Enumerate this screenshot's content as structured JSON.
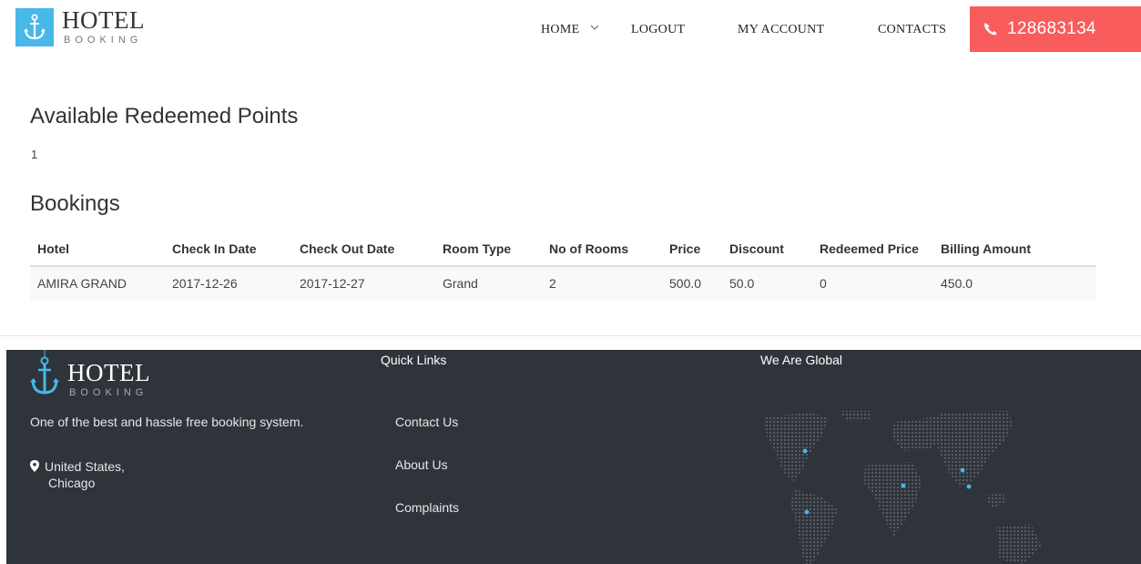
{
  "header": {
    "logo_title": "HOTEL",
    "logo_sub": "BOOKING",
    "nav": {
      "home": "HOME",
      "logout": "LOGOUT",
      "my_account": "MY ACCOUNT",
      "contacts": "CONTACTS"
    },
    "phone": "128683134"
  },
  "points": {
    "title": "Available Redeemed Points",
    "value": "1"
  },
  "bookings": {
    "title": "Bookings",
    "columns": [
      "Hotel",
      "Check In Date",
      "Check Out Date",
      "Room Type",
      "No of Rooms",
      "Price",
      "Discount",
      "Redeemed Price",
      "Billing Amount"
    ],
    "rows": [
      [
        "AMIRA GRAND",
        "2017-12-26",
        "2017-12-27",
        "Grand",
        "2",
        "500.0",
        "50.0",
        "0",
        "450.0"
      ]
    ]
  },
  "footer": {
    "logo_title": "HOTEL",
    "logo_sub": "BOOKING",
    "tagline": "One of the best and hassle free booking system.",
    "address_line1": "United States,",
    "address_line2": "Chicago",
    "quick_links_title": "Quick Links",
    "links": [
      "Contact Us",
      "About Us",
      "Complaints"
    ],
    "global_title": "We Are Global"
  },
  "colors": {
    "accent_blue": "#47b8e8",
    "phone_red": "#f85c5c",
    "footer_bg": "#2f343b"
  }
}
